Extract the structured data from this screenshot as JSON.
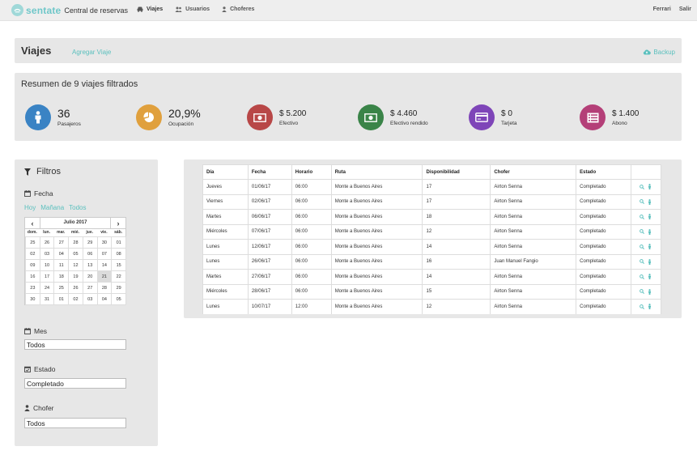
{
  "nav": {
    "brand": "sentate",
    "subtitle": "Central de reservas",
    "links": [
      {
        "label": "Viajes",
        "icon": "car-icon"
      },
      {
        "label": "Usuarios",
        "icon": "users-icon"
      },
      {
        "label": "Choferes",
        "icon": "person-icon"
      }
    ],
    "user": "Ferrari",
    "logout": "Salir"
  },
  "header": {
    "title": "Viajes",
    "add_link": "Agregar Viaje",
    "backup": "Backup"
  },
  "summary": {
    "title": "Resumen de 9 viajes filtrados",
    "stats": [
      {
        "value": "36",
        "label": "Pasajeros",
        "color": "#3a83c4",
        "icon": "person-icon"
      },
      {
        "value": "20,9%",
        "label": "Ocupación",
        "color": "#e0a03d",
        "icon": "pie-chart-icon"
      },
      {
        "value": "$ 5.200",
        "label": "Efectivo",
        "color": "#b84747",
        "icon": "cash-icon"
      },
      {
        "value": "$ 4.460",
        "label": "Efectivo rendido",
        "color": "#3a8448",
        "icon": "cash-icon"
      },
      {
        "value": "$ 0",
        "label": "Tarjeta",
        "color": "#7e45b8",
        "icon": "credit-card-icon"
      },
      {
        "value": "$ 1.400",
        "label": "Abono",
        "color": "#b43f78",
        "icon": "list-icon"
      }
    ]
  },
  "filters": {
    "title": "Filtros",
    "fecha_label": "Fecha",
    "quick": [
      "Hoy",
      "Mañana",
      "Todos"
    ],
    "calendar": {
      "month": "Julio 2017",
      "prev": "‹",
      "next": "›",
      "dow": [
        "dom.",
        "lun.",
        "mar.",
        "mié.",
        "jue.",
        "vie.",
        "sáb."
      ],
      "weeks": [
        [
          "25",
          "26",
          "27",
          "28",
          "29",
          "30",
          "01"
        ],
        [
          "02",
          "03",
          "04",
          "05",
          "06",
          "07",
          "08"
        ],
        [
          "09",
          "10",
          "11",
          "12",
          "13",
          "14",
          "15"
        ],
        [
          "16",
          "17",
          "18",
          "19",
          "20",
          "21",
          "22"
        ],
        [
          "23",
          "24",
          "25",
          "26",
          "27",
          "28",
          "29"
        ],
        [
          "30",
          "31",
          "01",
          "02",
          "03",
          "04",
          "05"
        ]
      ],
      "selected": "21"
    },
    "mes_label": "Mes",
    "mes_value": "Todos",
    "estado_label": "Estado",
    "estado_value": "Completado",
    "chofer_label": "Chofer",
    "chofer_value": "Todos"
  },
  "table": {
    "headers": [
      "Día",
      "Fecha",
      "Horario",
      "Ruta",
      "Disponibilidad",
      "Chofer",
      "Estado",
      ""
    ],
    "rows": [
      [
        "Jueves",
        "01/06/17",
        "06:00",
        "Monte a Buenos Aires",
        "17",
        "Airton Senna",
        "Completado"
      ],
      [
        "Viernes",
        "02/06/17",
        "06:00",
        "Monte a Buenos Aires",
        "17",
        "Airton Senna",
        "Completado"
      ],
      [
        "Martes",
        "06/06/17",
        "06:00",
        "Monte a Buenos Aires",
        "18",
        "Airton Senna",
        "Completado"
      ],
      [
        "Miércoles",
        "07/06/17",
        "06:00",
        "Monte a Buenos Aires",
        "12",
        "Airton Senna",
        "Completado"
      ],
      [
        "Lunes",
        "12/06/17",
        "06:00",
        "Monte a Buenos Aires",
        "14",
        "Airton Senna",
        "Completado"
      ],
      [
        "Lunes",
        "26/06/17",
        "06:00",
        "Monte a Buenos Aires",
        "16",
        "Juan Manuel Fangio",
        "Completado"
      ],
      [
        "Martes",
        "27/06/17",
        "06:00",
        "Monte a Buenos Aires",
        "14",
        "Airton Senna",
        "Completado"
      ],
      [
        "Miércoles",
        "28/06/17",
        "06:00",
        "Monte a Buenos Aires",
        "15",
        "Airton Senna",
        "Completado"
      ],
      [
        "Lunes",
        "10/07/17",
        "12:00",
        "Monte a Buenos Aires",
        "12",
        "Airton Senna",
        "Completado"
      ]
    ],
    "row_actions": [
      "search-icon",
      "person-icon"
    ]
  },
  "colors": {
    "accent": "#5bc0be",
    "panel": "#e7e7e7"
  }
}
